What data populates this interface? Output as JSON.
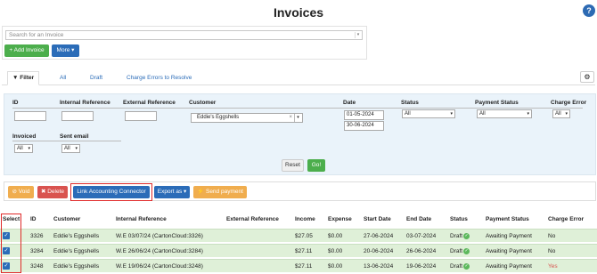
{
  "page": {
    "title": "Invoices",
    "help_icon": "question-icon"
  },
  "search": {
    "placeholder": "Search for an Invoice"
  },
  "toolbar": {
    "add_label": "+ Add Invoice",
    "more_label": "More ▾"
  },
  "tabs": [
    {
      "label": "Filter",
      "icon": "filter-icon"
    },
    {
      "label": "All"
    },
    {
      "label": "Draft"
    },
    {
      "label": "Charge Errors to Resolve"
    }
  ],
  "settings_icon": "gear-icon",
  "filter": {
    "labels": {
      "id": "ID",
      "internal_reference": "Internal Reference",
      "external_reference": "External Reference",
      "customer": "Customer",
      "date": "Date",
      "status": "Status",
      "payment_status": "Payment Status",
      "charge_error": "Charge Error",
      "invoiced": "Invoiced",
      "sent_email": "Sent email"
    },
    "customer_value": "Eddie's Eggshells",
    "date_from": "01-05-2024",
    "date_to": "30-06-2024",
    "status_value": "All",
    "payment_status_value": "All",
    "charge_error_value": "All",
    "invoiced_value": "All",
    "sent_email_value": "All",
    "reset_label": "Reset",
    "go_label": "Go!"
  },
  "actions": {
    "void_label": "⊘ Void",
    "delete_label": "✖ Delete",
    "link_label": "Link Accounting Connector",
    "export_label": "Export as ▾",
    "send_label": "⚡ Send payment"
  },
  "table": {
    "headers": [
      "Select",
      "ID",
      "Customer",
      "Internal Reference",
      "External Reference",
      "Income",
      "Expense",
      "Start Date",
      "End Date",
      "Status",
      "Payment Status",
      "Charge Error"
    ],
    "rows": [
      {
        "id": "3326",
        "customer": "Eddie's Eggshells",
        "internal": "W.E 03/07/24 (CartonCloud:3326)",
        "external": "",
        "income": "$27.05",
        "expense": "$0.00",
        "start": "27-06-2024",
        "end": "03-07-2024",
        "status": "Draft",
        "payment": "Awaiting Payment",
        "charge_error": "No"
      },
      {
        "id": "3284",
        "customer": "Eddie's Eggshells",
        "internal": "W.E 26/06/24 (CartonCloud:3284)",
        "external": "",
        "income": "$27.11",
        "expense": "$0.00",
        "start": "20-06-2024",
        "end": "26-06-2024",
        "status": "Draft",
        "payment": "Awaiting Payment",
        "charge_error": "No"
      },
      {
        "id": "3248",
        "customer": "Eddie's Eggshells",
        "internal": "W.E 19/06/24 (CartonCloud:3248)",
        "external": "",
        "income": "$27.11",
        "expense": "$0.00",
        "start": "13-06-2024",
        "end": "19-06-2024",
        "status": "Draft",
        "payment": "Awaiting Payment",
        "charge_error": "Yes"
      }
    ]
  }
}
